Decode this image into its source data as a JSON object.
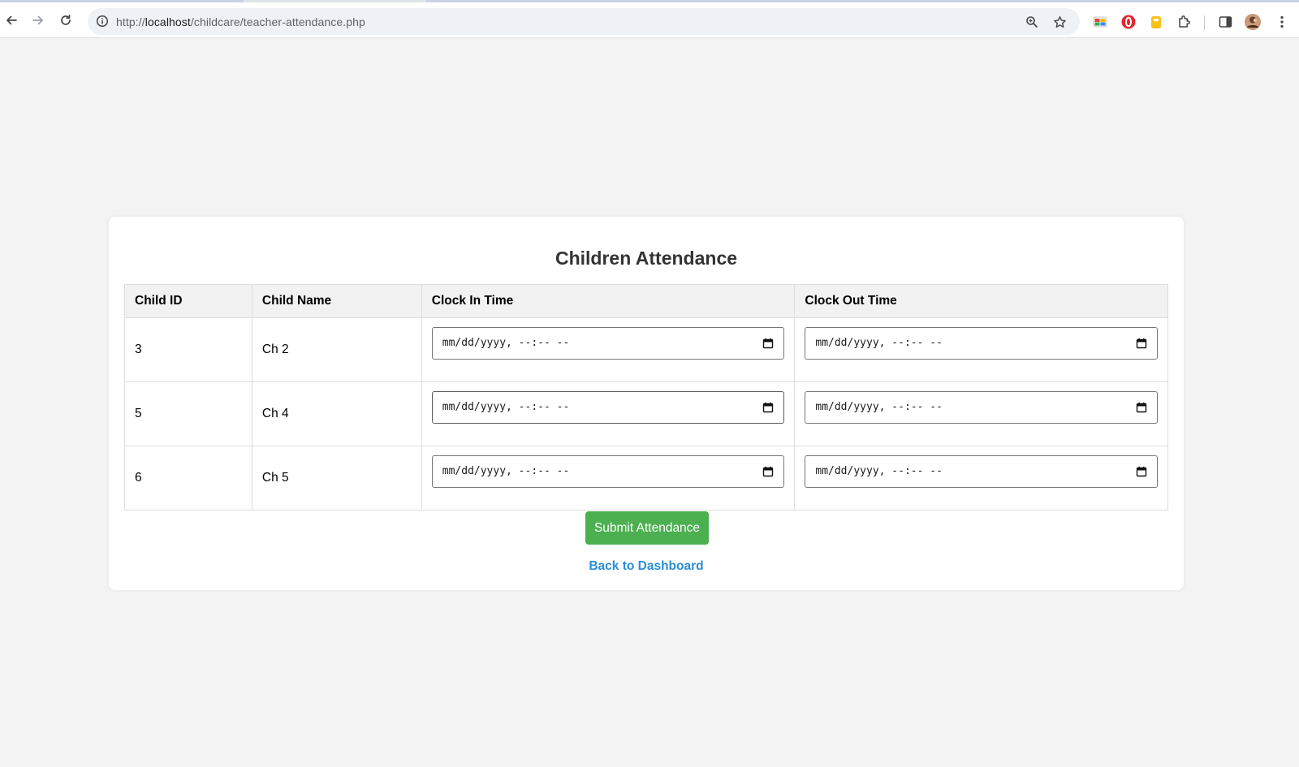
{
  "browser": {
    "url_prefix": "http://",
    "url_host": "localhost",
    "url_path": "/childcare/teacher-attendance.php"
  },
  "page": {
    "title": "Children Attendance",
    "columns": [
      "Child ID",
      "Child Name",
      "Clock In Time",
      "Clock Out Time"
    ],
    "rows": [
      {
        "id": "3",
        "name": "Ch 2",
        "clock_in": "mm/dd/yyyy, --:-- --",
        "clock_out": "mm/dd/yyyy, --:-- --"
      },
      {
        "id": "5",
        "name": "Ch 4",
        "clock_in": "mm/dd/yyyy, --:-- --",
        "clock_out": "mm/dd/yyyy, --:-- --"
      },
      {
        "id": "6",
        "name": "Ch 5",
        "clock_in": "mm/dd/yyyy, --:-- --",
        "clock_out": "mm/dd/yyyy, --:-- --"
      }
    ],
    "submit_label": "Submit Attendance",
    "back_label": "Back to Dashboard"
  },
  "colors": {
    "submit_bg": "#4caf50",
    "link": "#2a8ed8",
    "page_bg": "#f3f3f3"
  },
  "icons": [
    "back-arrow-icon",
    "forward-arrow-icon",
    "reload-icon",
    "info-icon",
    "zoom-icon",
    "star-icon",
    "extension-icon",
    "puzzle-icon",
    "side-panel-icon",
    "profile-avatar",
    "menu-icon",
    "calendar-icon"
  ]
}
